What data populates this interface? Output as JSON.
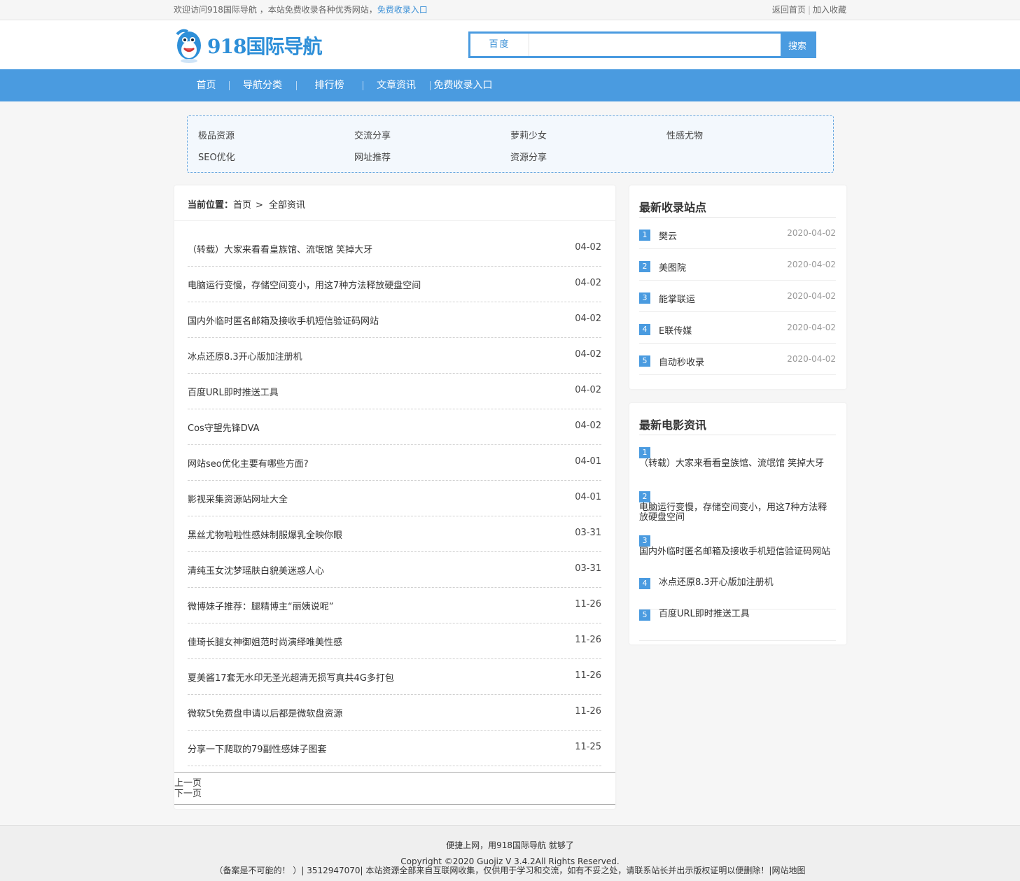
{
  "topbar": {
    "welcome": "欢迎访问918国际导航 ，本站免费收录各种优秀网站，",
    "free_link": "免费收录入口",
    "home": "返回首页",
    "favorite": "加入收藏"
  },
  "logo": {
    "text": "918国际导航"
  },
  "search": {
    "engine": "百度",
    "placeholder": "",
    "button": "搜索"
  },
  "nav": [
    "首页",
    "导航分类",
    "排行榜",
    "文章资讯",
    "免费收录入口"
  ],
  "categories": [
    "极品资源",
    "交流分享",
    "萝莉少女",
    "性感尤物",
    "SEO优化",
    "网址推荐",
    "资源分享"
  ],
  "breadcrumb": {
    "label": "当前位置：",
    "home": "首页",
    "arrow": ">",
    "current": "全部资讯"
  },
  "articles": [
    {
      "title": "（转载）大家来看看皇族馆、流氓馆 笑掉大牙",
      "date": "04-02"
    },
    {
      "title": "电脑运行变慢，存储空间变小，用这7种方法释放硬盘空间",
      "date": "04-02"
    },
    {
      "title": "国内外临时匿名邮箱及接收手机短信验证码网站",
      "date": "04-02"
    },
    {
      "title": "冰点还原8.3开心版加注册机",
      "date": "04-02"
    },
    {
      "title": "百度URL即时推送工具",
      "date": "04-02"
    },
    {
      "title": "Cos守望先锋DVA",
      "date": "04-02"
    },
    {
      "title": "网站seo优化主要有哪些方面?",
      "date": "04-01"
    },
    {
      "title": "影视采集资源站网址大全",
      "date": "04-01"
    },
    {
      "title": "黑丝尤物啦啦性感妹制服爆乳全映你眼",
      "date": "03-31"
    },
    {
      "title": "清纯玉女沈梦瑶肤白貌美迷惑人心",
      "date": "03-31"
    },
    {
      "title": "微博妹子推荐：腿精博主“丽姨说呢”",
      "date": "11-26"
    },
    {
      "title": "佳琦长腿女神御姐范时尚演绎唯美性感",
      "date": "11-26"
    },
    {
      "title": "夏美酱17套无水印无圣光超清无损写真共4G多打包",
      "date": "11-26"
    },
    {
      "title": "微软5t免费盘申请以后都是微软盘资源",
      "date": "11-26"
    },
    {
      "title": "分享一下爬取的79副性感妹子图套",
      "date": "11-25"
    }
  ],
  "pager": {
    "prev": "上一页",
    "next": "下一页"
  },
  "latest_sites": {
    "title": "最新收录站点",
    "items": [
      {
        "num": "1",
        "name": "樊云",
        "date": "2020-04-02"
      },
      {
        "num": "2",
        "name": "美图院",
        "date": "2020-04-02"
      },
      {
        "num": "3",
        "name": "能掌联运",
        "date": "2020-04-02"
      },
      {
        "num": "4",
        "name": "E联传媒",
        "date": "2020-04-02"
      },
      {
        "num": "5",
        "name": "自动秒收录",
        "date": "2020-04-02"
      }
    ]
  },
  "latest_news": {
    "title": "最新电影资讯",
    "items": [
      {
        "num": "1",
        "title": "（转载）大家来看看皇族馆、流氓馆 笑掉大牙"
      },
      {
        "num": "2",
        "title": "电脑运行变慢，存储空间变小，用这7种方法释放硬盘空间"
      },
      {
        "num": "3",
        "title": "国内外临时匿名邮箱及接收手机短信验证码网站"
      },
      {
        "num": "4",
        "title": "冰点还原8.3开心版加注册机"
      },
      {
        "num": "5",
        "title": "百度URL即时推送工具"
      }
    ]
  },
  "footer": {
    "slogan": "便捷上网，用918国际导航 就够了",
    "copyright": "Copyright ©2020 Guojiz V 3.4.2All Rights Reserved.",
    "notice": "（备案是不可能的！ ）| 3512947070| 本站资源全部来自互联网收集，仅供用于学习和交流，如有不妥之处，请联系站长并出示版权证明以便删除！|网站地图"
  },
  "colors": {
    "accent": "#4a9be0",
    "link": "#3a8fd6"
  }
}
